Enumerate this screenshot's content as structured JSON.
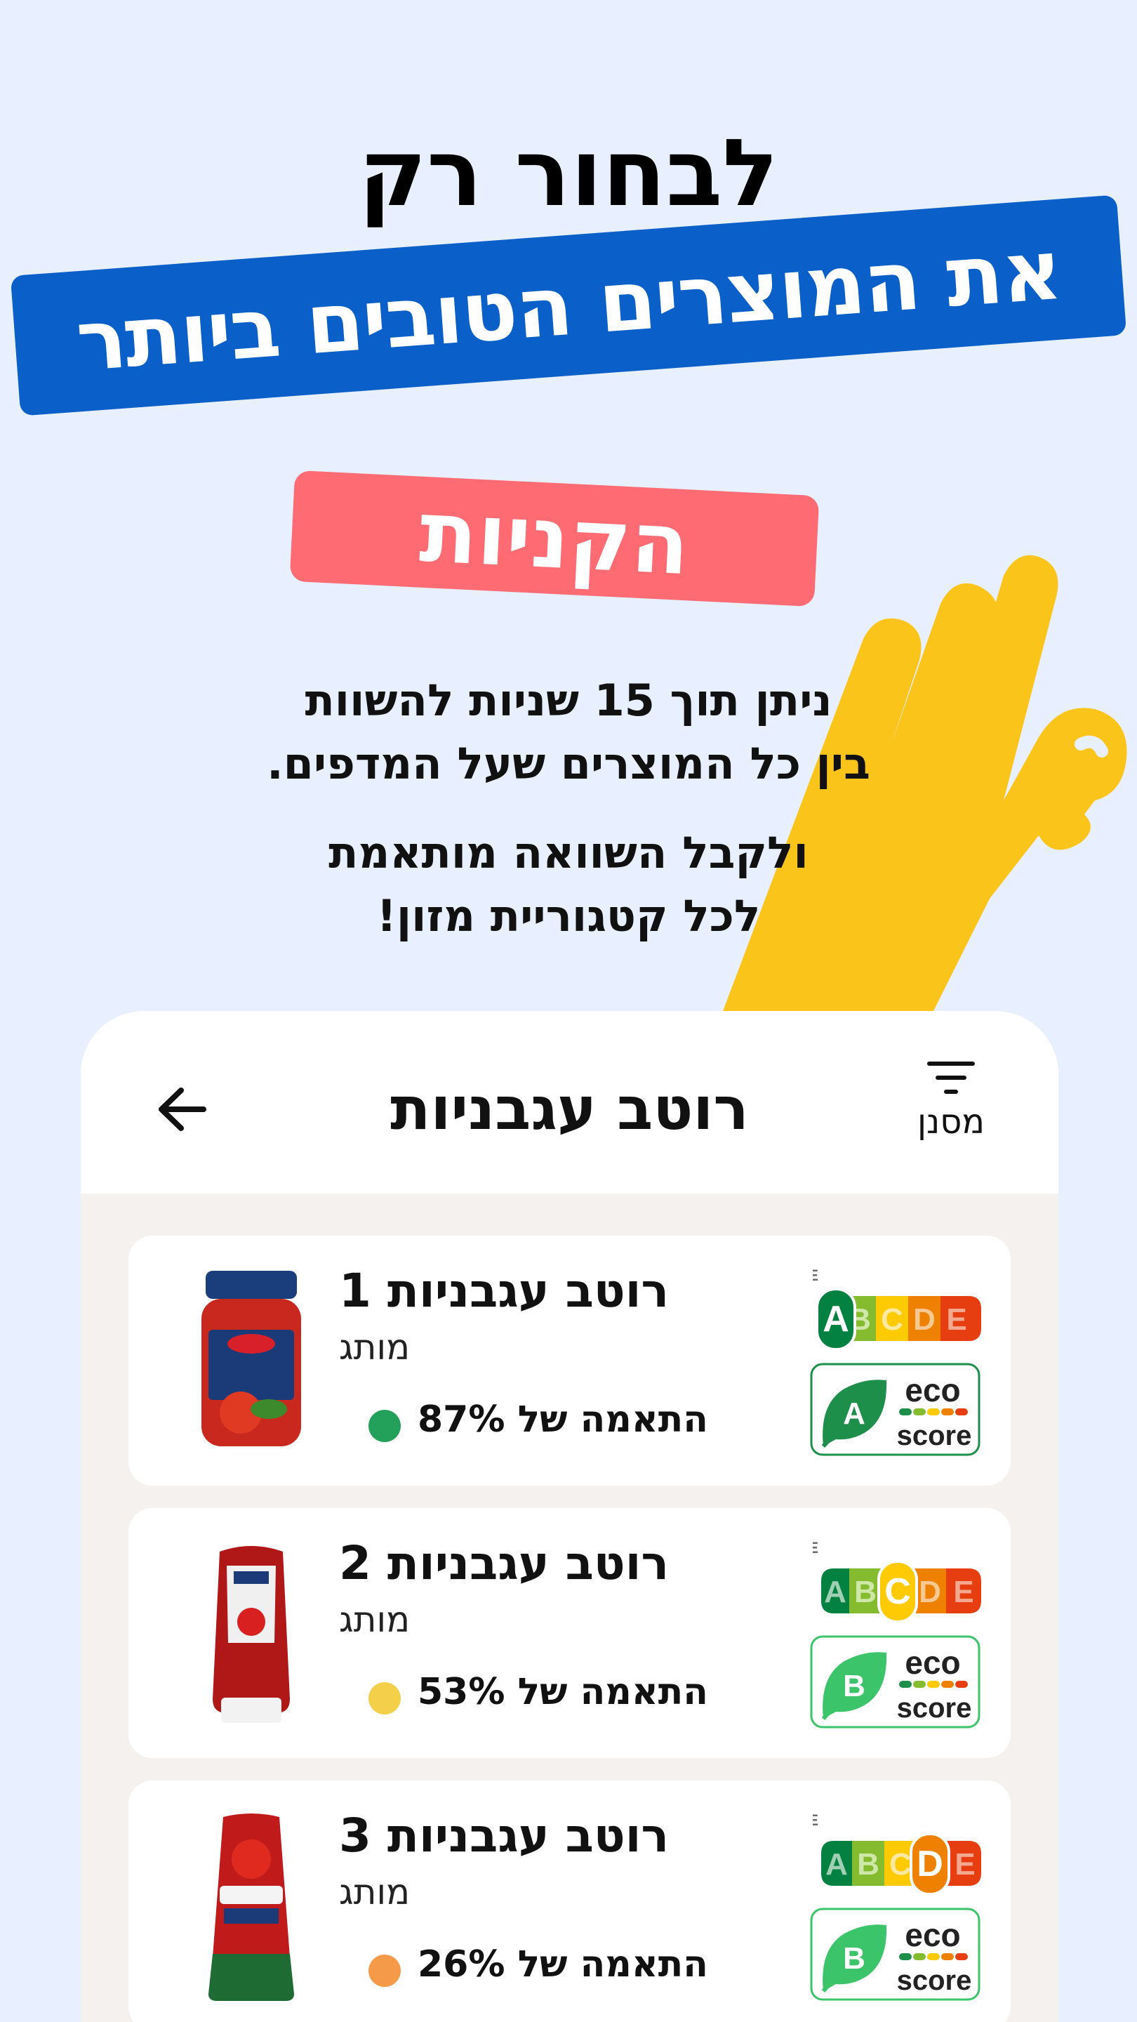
{
  "promo": {
    "headline_top": "לבחור רק",
    "headline_banner": "את המוצרים הטובים ביותר",
    "tag": "הקניות",
    "text_line1": "ניתן תוך 15 שניות להשוות",
    "text_line2": "בין כל המוצרים שעל המדפים.",
    "text_line3": "ולקבל השוואה מותאמת",
    "text_line4": "לכל קטגוריית מזון!"
  },
  "app": {
    "title": "רוטב עגבניות",
    "filter_label": "מסנן",
    "back_icon": "arrow-left-icon",
    "filter_icon": "filter-icon"
  },
  "products": [
    {
      "name": "רוטב עגבניות 1",
      "brand": "מותג",
      "match": "87% התאמה של",
      "match_color": "#23a05a",
      "nutri_grade": "A",
      "eco_grade": "A",
      "image": "pasta-sauce-jar"
    },
    {
      "name": "רוטב עגבניות 2",
      "brand": "מותג",
      "match": "53% התאמה של",
      "match_color": "#f4cf4a",
      "nutri_grade": "C",
      "eco_grade": "B",
      "image": "ketchup-bottle"
    },
    {
      "name": "רוטב עגבניות 3",
      "brand": "מותג",
      "match": "26% התאמה של",
      "match_color": "#f59a48",
      "nutri_grade": "D",
      "eco_grade": "B",
      "image": "ketchup-squeeze-bottle"
    }
  ],
  "labels": {
    "nutri_title": "NUTRI-SCORE",
    "eco_word_top": "eco",
    "eco_word_bottom": "score",
    "nutri_letters": [
      "A",
      "B",
      "C",
      "D",
      "E"
    ]
  },
  "colors": {
    "background": "#e8efff",
    "banner_blue": "#0a5fc8",
    "banner_pink": "#ff6b72",
    "hand_yellow": "#fbc41a"
  }
}
